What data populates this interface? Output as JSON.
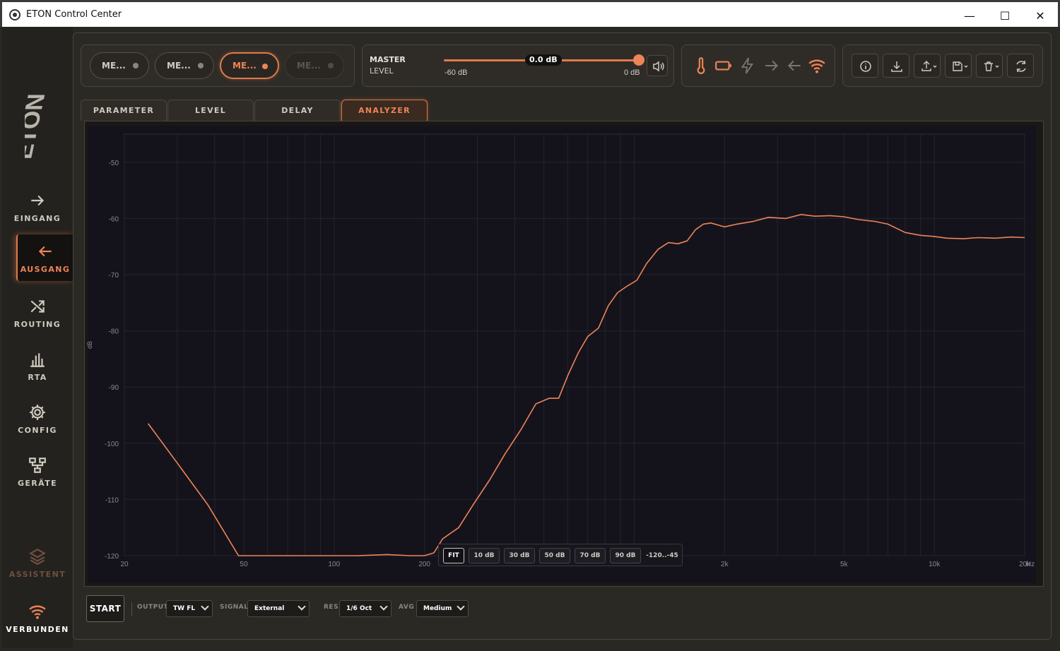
{
  "window": {
    "title": "ETON Control Center",
    "minimize": "—",
    "maximize": "☐",
    "close": "✕"
  },
  "sidebar": {
    "items": [
      {
        "label": "EINGANG",
        "icon": "arrow-right-icon"
      },
      {
        "label": "AUSGANG",
        "icon": "arrow-left-icon"
      },
      {
        "label": "ROUTING",
        "icon": "shuffle-icon"
      },
      {
        "label": "RTA",
        "icon": "bars-icon"
      },
      {
        "label": "CONFIG",
        "icon": "gear-icon"
      },
      {
        "label": "GERÄTE",
        "icon": "devices-icon"
      },
      {
        "label": "ASSISTENT",
        "icon": "layers-icon"
      },
      {
        "label": "VERBUNDEN",
        "icon": "wifi-icon"
      }
    ]
  },
  "memory": {
    "buttons": [
      {
        "label": "ME..."
      },
      {
        "label": "ME..."
      },
      {
        "label": "ME..."
      },
      {
        "label": "ME..."
      }
    ]
  },
  "master": {
    "title": "MASTER",
    "subtitle": "LEVEL",
    "value": "0.0 dB",
    "level_fraction": 1.0,
    "min_label": "-60 dB",
    "max_label": "0 dB"
  },
  "status_icons": [
    "thermometer-icon",
    "battery-icon",
    "bolt-icon",
    "arrow-right-icon",
    "arrow-left-icon",
    "wifi-icon"
  ],
  "status_colors": {
    "accent": "#ee8457",
    "disabled": "#7a7670"
  },
  "tools": [
    "info-icon",
    "download-icon",
    "upload-icon",
    "save-icon",
    "delete-icon",
    "refresh-icon"
  ],
  "tabs": [
    {
      "label": "PARAMETER"
    },
    {
      "label": "LEVEL"
    },
    {
      "label": "DELAY"
    },
    {
      "label": "ANALYZER"
    }
  ],
  "range_buttons": [
    "FIT",
    "10 dB",
    "30 dB",
    "50 dB",
    "70 dB",
    "90 dB",
    "-120..-45"
  ],
  "controls": {
    "start": "START",
    "output_label": "OUTPUT",
    "output_value": "TW FL",
    "signal_label": "SIGNAL",
    "signal_value": "External",
    "res_label": "RES",
    "res_value": "1/6 Oct",
    "avg_label": "AVG",
    "avg_value": "Medium"
  },
  "chart_data": {
    "type": "line",
    "xscale": "log",
    "xlim": [
      20,
      20000
    ],
    "ylim": [
      -120,
      -45
    ],
    "ylabel": "dB",
    "xunit": "Hz",
    "x_ticks": [
      {
        "value": 20,
        "label": "20"
      },
      {
        "value": 50,
        "label": "50"
      },
      {
        "value": 100,
        "label": "100"
      },
      {
        "value": 200,
        "label": "200"
      },
      {
        "value": 2000,
        "label": "2k"
      },
      {
        "value": 5000,
        "label": "5k"
      },
      {
        "value": 10000,
        "label": "10k"
      },
      {
        "value": 20000,
        "label": "20k"
      }
    ],
    "y_ticks": [
      -50,
      -60,
      -70,
      -80,
      -90,
      -100,
      -110,
      -120
    ],
    "grid": true,
    "line_color": "#ee8457",
    "series": [
      {
        "x": [
          24,
          30,
          38,
          48,
          60,
          80,
          100,
          120,
          150,
          180,
          200,
          215,
          230,
          260,
          290,
          330,
          370,
          420,
          470,
          520,
          560,
          600,
          650,
          700,
          760,
          820,
          880,
          950,
          1020,
          1100,
          1200,
          1300,
          1400,
          1500,
          1600,
          1700,
          1800,
          2000,
          2200,
          2500,
          2800,
          3200,
          3600,
          4000,
          4500,
          5000,
          5600,
          6300,
          7000,
          8000,
          9000,
          10000,
          11000,
          12500,
          14000,
          16000,
          18000,
          20000
        ],
        "y": [
          -96.5,
          -103.5,
          -111,
          -120,
          -120,
          -120,
          -120,
          -120,
          -119.8,
          -120,
          -120,
          -119.5,
          -117,
          -115,
          -111,
          -106.5,
          -102,
          -97.5,
          -93,
          -92,
          -92,
          -88,
          -84,
          -81,
          -79.5,
          -75.5,
          -73.2,
          -72,
          -71,
          -68,
          -65.5,
          -64.3,
          -64.5,
          -64,
          -62,
          -61,
          -60.8,
          -61.5,
          -61,
          -60.5,
          -59.8,
          -60,
          -59.3,
          -59.6,
          -59.5,
          -59.7,
          -60.2,
          -60.5,
          -61,
          -62.5,
          -63,
          -63.2,
          -63.5,
          -63.6,
          -63.4,
          -63.5,
          -63.3,
          -63.4
        ]
      }
    ]
  }
}
